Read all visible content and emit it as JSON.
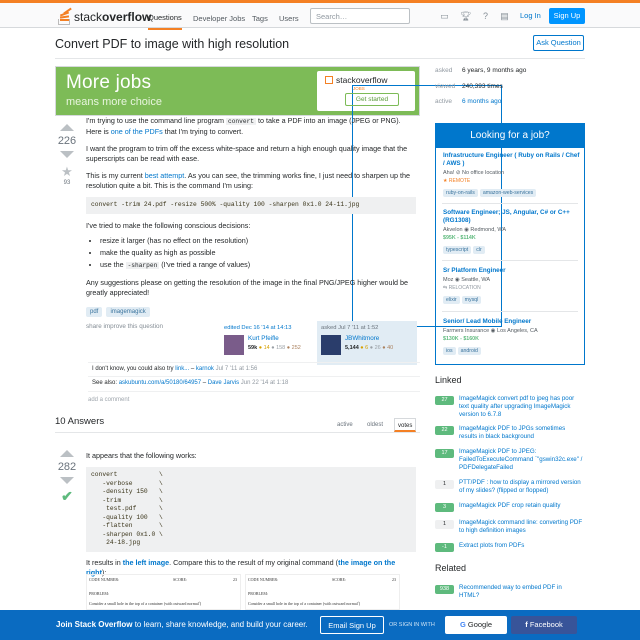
{
  "brand": {
    "logo_text_1": "stack",
    "logo_text_2": "overflow",
    "accent": "#f48024"
  },
  "nav": {
    "questions": "Questions",
    "jobs": "Developer Jobs",
    "tags": "Tags",
    "users": "Users"
  },
  "search": {
    "placeholder": "Search…"
  },
  "auth": {
    "login": "Log In",
    "signup": "Sign Up"
  },
  "question": {
    "title": "Convert PDF to image with high resolution",
    "ask_button": "Ask Question",
    "votes": "226",
    "favorites": "93",
    "p1a": "I'm trying to use the command line program ",
    "p1code": "convert",
    "p1b": " to take a PDF into an image (JPEG or PNG). Here is ",
    "p1link": "one of the PDFs",
    "p1c": " that I'm trying to convert.",
    "p2": "I want the program to trim off the excess white-space and return a high enough quality image that the superscripts can be read with ease.",
    "p3a": "This is my current ",
    "p3link": "best attempt",
    "p3b": ". As you can see, the trimming works fine, I just need to sharpen up the resolution quite a bit. This is the command I'm using:",
    "code": "convert -trim 24.pdf -resize 500% -quality 100 -sharpen 0x1.0 24-11.jpg",
    "p4": "I've tried to make the following conscious decisions:",
    "bullets": [
      "resize it larger (has no effect on the resolution)",
      "make the quality as high as possible"
    ],
    "b3a": "use the ",
    "b3code": "-sharpen",
    "b3b": " (I've tried a range of values)",
    "p5": "Any suggestions please on getting the resolution of the image in the final PNG/JPEG higher would be greatly appreciated!",
    "tags": [
      "pdf",
      "imagemagick"
    ],
    "menu": "share  improve this question",
    "edited": {
      "label": "edited Dec 16 '14 at 14:13",
      "name": "Kurt Pfeifle",
      "rep": "59k",
      "gold": "● 14",
      "silver": "● 158",
      "bronze": "● 252"
    },
    "asked": {
      "label": "asked Jul 7 '11 at 1:52",
      "name": "JBWhitmore",
      "rep": "5,144",
      "gold": "● 6",
      "silver": "● 26",
      "bronze": "● 40"
    },
    "comments": [
      {
        "text": "I don't know, you could also try ",
        "link": "link...",
        "dash": " – ",
        "user": "karnok",
        "time": " Jul 7 '11 at 1:56"
      },
      {
        "text": "See also: ",
        "link": "askubuntu.com/a/50180/64957",
        "dash": " – ",
        "user": "Dave Jarvis",
        "time": " Jun 22 '14 at 1:18"
      }
    ],
    "add_comment": "add a comment"
  },
  "stats": {
    "asked_label": "asked",
    "asked": "6 years, 9 months ago",
    "viewed_label": "viewed",
    "viewed": "240,393 times",
    "active_label": "active",
    "active": "6 months ago"
  },
  "ad": {
    "big": "More jobs",
    "small": "means more choice",
    "logo": "stackoverflow",
    "jobs": "JOBS",
    "button": "Get started"
  },
  "jobs_panel": {
    "header": "Looking for a job?",
    "items": [
      {
        "title": "Infrastructure Engineer ( Ruby on Rails / Chef / AWS )",
        "company": "Aha!  ⊘ No office location",
        "extra": "★ REMOTE",
        "tags": [
          "ruby-on-rails",
          "amazon-web-services"
        ]
      },
      {
        "title": "Software Engineer; JS, Angular, C# or C++ (RG1308)",
        "company": "Akvelon  ◉ Redmond, WA",
        "extra": "$95K - $114K",
        "tags": [
          "typescript",
          "clr"
        ]
      },
      {
        "title": "Sr Platform Engineer",
        "company": "Moz  ◉ Seattle, WA",
        "extra": "⇆ RELOCATION",
        "tags": [
          "elixir",
          "mysql"
        ]
      },
      {
        "title": "Senior/ Lead Mobile Engineer",
        "company": "Farmers Insurance  ◉ Los Angeles, CA",
        "extra": "$130K - $160K",
        "tags": [
          "ios",
          "android"
        ]
      }
    ]
  },
  "linked": {
    "title": "Linked",
    "items": [
      {
        "score": "27",
        "text": "ImageMagick convert pdf to jpeg has poor text quality after upgrading ImageMagick version to 6.7.8"
      },
      {
        "score": "22",
        "text": "ImageMagick PDF to JPGs sometimes results in black background"
      },
      {
        "score": "17",
        "text": "ImageMagick PDF to JPEG: FailedToExecuteCommand `\"gswin32c.exe\" / PDFDelegateFailed"
      },
      {
        "score": "1",
        "text": "PTT/PDF : how to display a mirrored version of my slides? (flipped or flopped)"
      },
      {
        "score": "3",
        "text": "ImageMagick PDF crop retain quality"
      },
      {
        "score": "1",
        "text": "ImageMagick command line: converting PDF to high definition images"
      },
      {
        "score": "-1",
        "text": "Extract plots from PDFs"
      }
    ]
  },
  "related": {
    "title": "Related",
    "items": [
      {
        "score": "938",
        "text": "Recommended way to embed PDF in HTML?"
      }
    ]
  },
  "answers": {
    "count_label": "10 Answers",
    "tabs": [
      "active",
      "oldest",
      "votes"
    ],
    "votes": "282",
    "p1": "It appears that the following works:",
    "code": "convert           \\\n   -verbose       \\\n   -density 150   \\\n   -trim          \\\n    test.pdf      \\\n   -quality 100   \\\n   -flatten       \\\n   -sharpen 0x1.0 \\\n    24-18.jpg",
    "p2a": "It results in ",
    "p2link1": "the left image",
    "p2b": ". Compare this to the result of my original command (",
    "p2link2": "the image on the right",
    "p2c": "):",
    "paper": {
      "code_number": "CODE NUMBER:",
      "score": "SCORE:",
      "num": "23",
      "problem": "PROBLEM:",
      "line": "Consider a small hole in the top of a container (with outward normal ̂)"
    }
  },
  "footer": {
    "text1": "Join Stack Overflow",
    "text2": " to learn, share knowledge, and build your career.",
    "email": "Email Sign Up",
    "or": "OR SIGN IN WITH",
    "google": "Google",
    "facebook": "Facebook"
  }
}
